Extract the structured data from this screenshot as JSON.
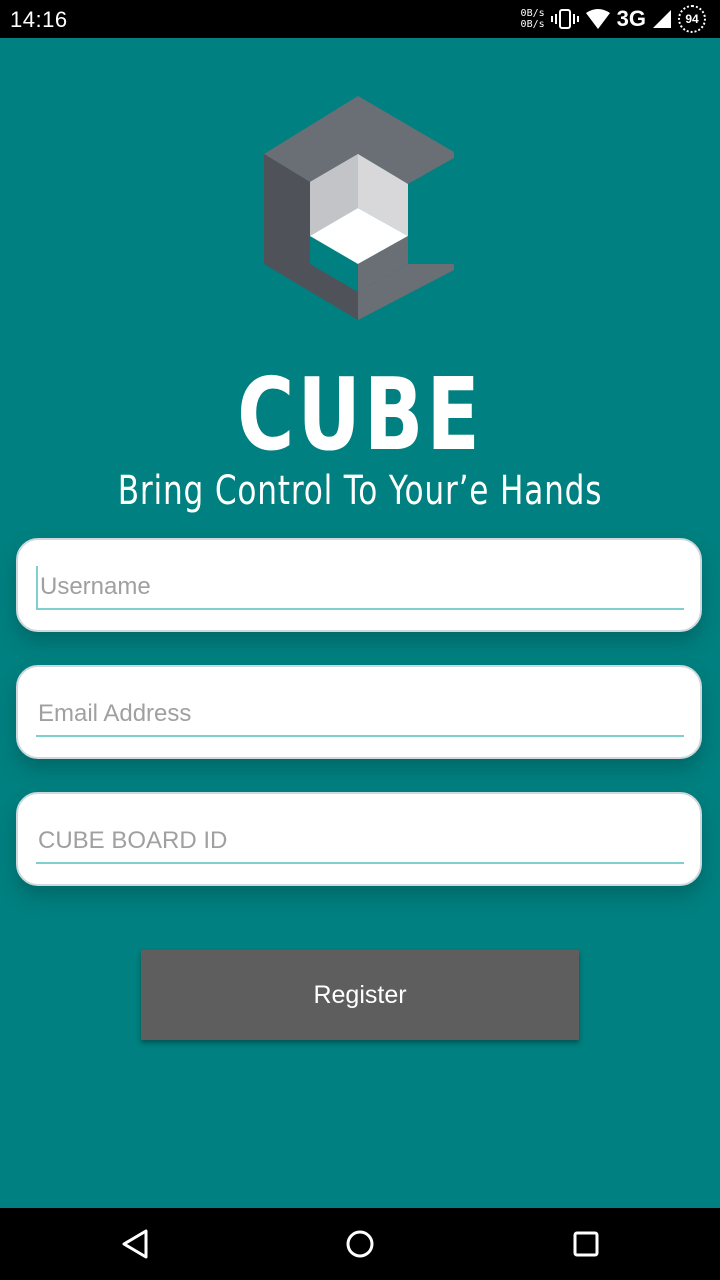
{
  "status_bar": {
    "time": "14:16",
    "net_up": "0B/s",
    "net_down": "0B/s",
    "network": "3G",
    "battery": "94"
  },
  "brand": {
    "name": "CUBE",
    "tagline": "Bring Control To Your’e Hands",
    "logo_icon": "cube-logo-icon"
  },
  "form": {
    "username_placeholder": "Username",
    "email_placeholder": "Email Address",
    "board_id_placeholder": "CUBE BOARD ID",
    "register_label": "Register"
  },
  "nav": {
    "back_icon": "triangle-back-icon",
    "home_icon": "circle-home-icon",
    "recents_icon": "square-recents-icon"
  },
  "colors": {
    "background": "#008080",
    "button": "#5e5e5e",
    "underline": "#7fcfcf"
  }
}
